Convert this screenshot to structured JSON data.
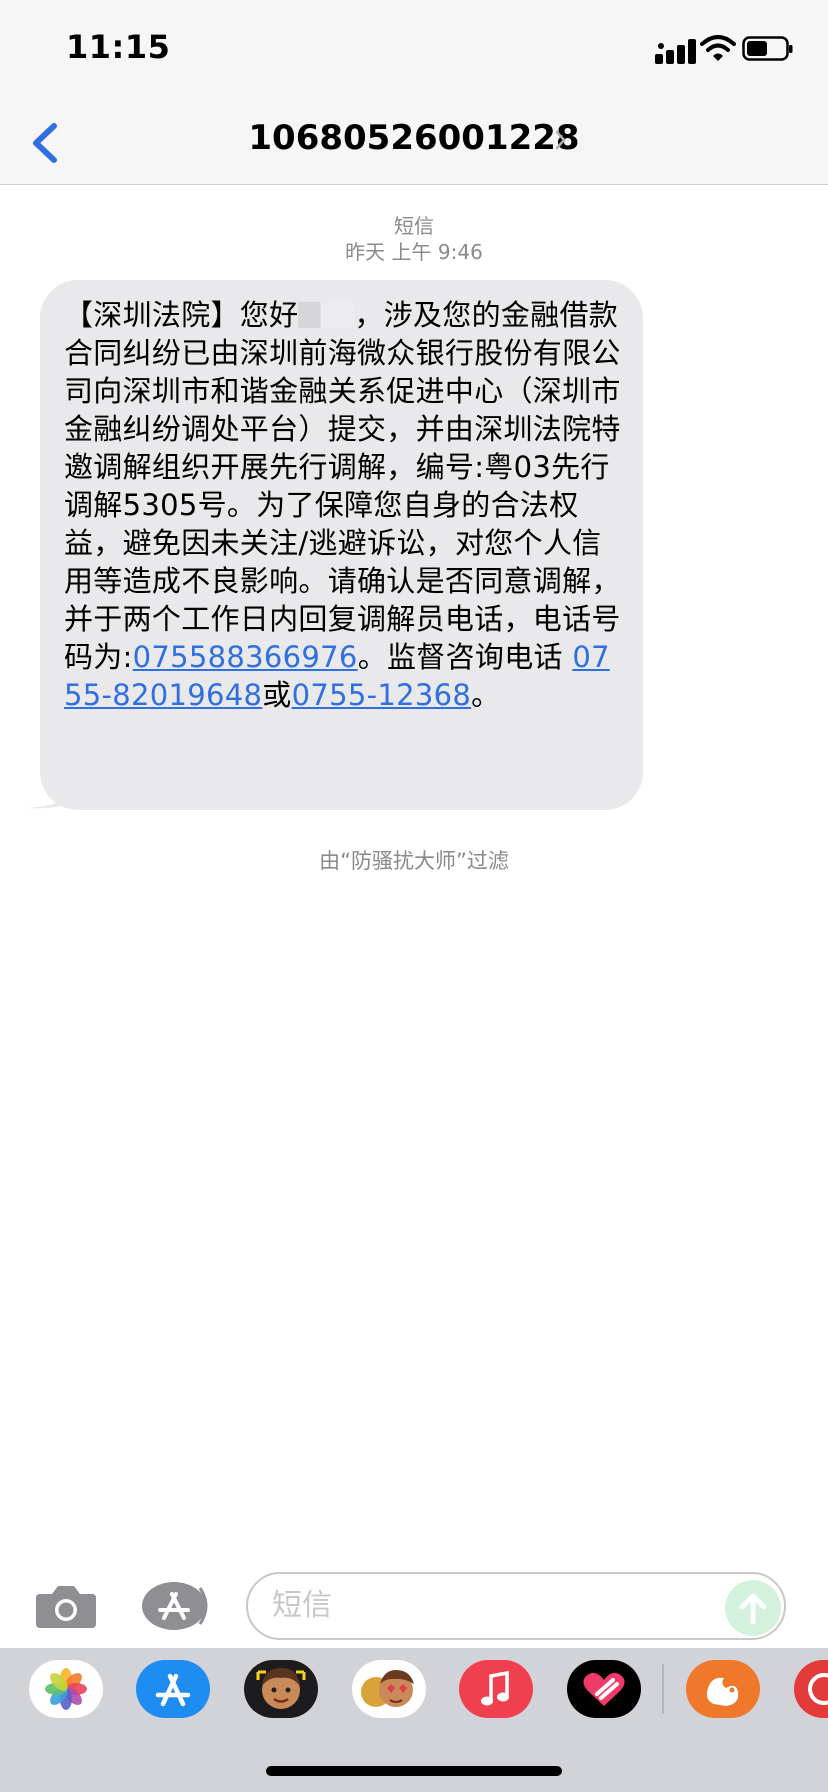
{
  "status_bar": {
    "time": "11:15"
  },
  "nav": {
    "contact_number": "10680526001228"
  },
  "conversation": {
    "service_label": "短信",
    "timestamp": "昨天 上午 9:46",
    "message": {
      "part1": "【深圳法院】您好",
      "part2": "，涉及您的金融借款合同纠纷已由深圳前海微众银行股份有限公司向深圳市和谐金融关系促进中心（深圳市金融纠纷调处平台）提交，并由深圳法院特邀调解组织开展先行调解，编号:粤03先行调解5305号。为了保障您自身的合法权益，避免因未关注/逃避诉讼，对您个人信用等造成不良影响。请确认是否同意调解，并于两个工作日内回复调解员电话，电话号码为:",
      "phone1": "075588366976",
      "part3": "。监督咨询电话",
      "phone2": "0755-82019648",
      "part4": "或",
      "phone3": "0755-12368",
      "part5": "。"
    },
    "filter_note": "由“防骚扰大师”过滤"
  },
  "input": {
    "placeholder": "短信"
  },
  "colors": {
    "accent": "#2f6fe0",
    "bubble": "#e9e9eb",
    "meta_text": "#8a8a8e",
    "send_disabled": "#d3f1dc"
  },
  "app_drawer": {
    "apps": [
      {
        "icon": "photos-icon"
      },
      {
        "icon": "app-store-icon"
      },
      {
        "icon": "memoji-icon"
      },
      {
        "icon": "animoji-stickers-icon"
      },
      {
        "icon": "music-icon"
      },
      {
        "icon": "digital-touch-icon"
      },
      {
        "icon": "squirrel-app-icon"
      },
      {
        "icon": "partial-app-icon"
      }
    ]
  }
}
